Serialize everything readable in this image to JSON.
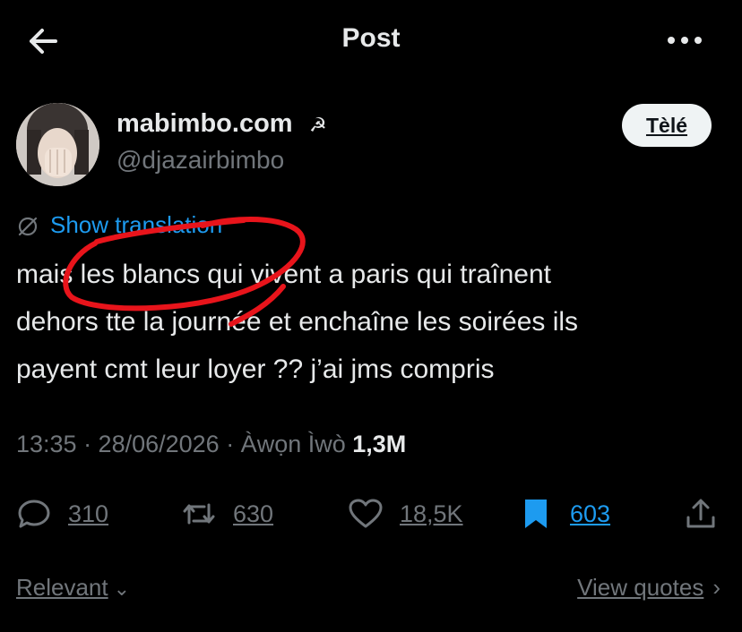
{
  "header": {
    "title": "Post",
    "back_icon": "arrow-left-icon",
    "more_icon": "more-horizontal-icon"
  },
  "author": {
    "display_name": "mabimbo.com",
    "name_glyph": "☭",
    "handle": "@djazairbimbo",
    "follow_label": "Tèlé"
  },
  "tweet": {
    "translate_label": "Show translation",
    "lines": [
      "mais les blancs qui vivent a paris qui traînent",
      "dehors tte la journée et enchaîne les soirées ils",
      "payent cmt leur loyer ?? j’ai jms compris"
    ],
    "meta_text": "13:35 · 28/06/2026 · Àwọn Ìwò ",
    "views": "1,3M"
  },
  "actions": {
    "replies": "310",
    "reposts": "630",
    "likes": "18,5K",
    "bookmarks": "603"
  },
  "footer": {
    "sort_label": "Relevant",
    "quotes_label": "View quotes"
  },
  "colors": {
    "background": "#000000",
    "accent": "#1d9bf0",
    "muted": "#71767b",
    "text": "#e7e9ea",
    "scribble": "#e8141b"
  }
}
